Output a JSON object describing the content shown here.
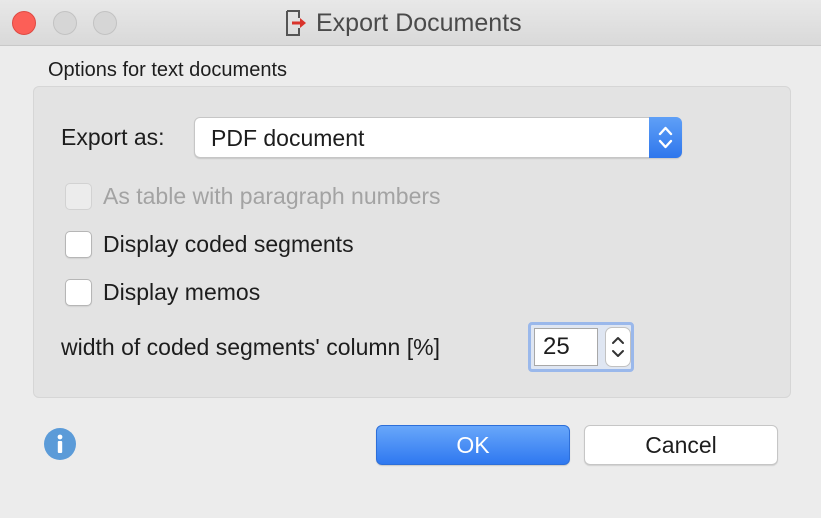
{
  "window": {
    "title": "Export Documents",
    "title_icon": "export-arrow-icon"
  },
  "options": {
    "section_label": "Options for text documents",
    "export_as_label": "Export as:",
    "export_as_value": "PDF document",
    "checkboxes": [
      {
        "label": "As table with paragraph numbers",
        "checked": false,
        "disabled": true
      },
      {
        "label": "Display coded segments",
        "checked": false,
        "disabled": false
      },
      {
        "label": "Display memos",
        "checked": false,
        "disabled": false
      }
    ],
    "column_width_label": "width of coded segments' column [%]",
    "column_width_value": "25"
  },
  "footer": {
    "ok_label": "OK",
    "cancel_label": "Cancel",
    "info_icon": "info-icon"
  },
  "colors": {
    "accent": "#2f78f0",
    "close_button": "#fc5f57",
    "export_icon": "#d9332b",
    "info_icon": "#5b9bd8"
  }
}
